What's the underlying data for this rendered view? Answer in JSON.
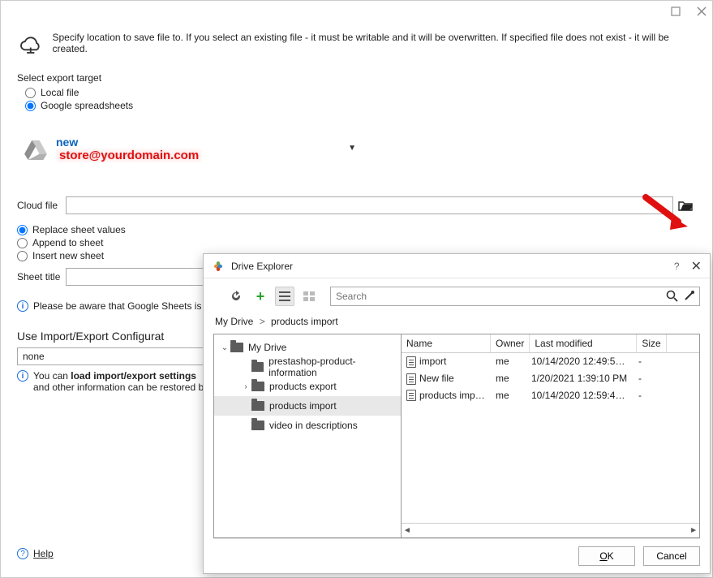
{
  "header": {
    "notice": "Specify location to save file to. If you select an existing file - it must be writable and it will be overwritten. If specified file does not exist - it will be created."
  },
  "target": {
    "label": "Select export target",
    "options": {
      "local": "Local file",
      "google": "Google spreadsheets"
    }
  },
  "account": {
    "name": "new",
    "email": "store@yourdomain.com"
  },
  "cloudfile": {
    "label": "Cloud file",
    "value": ""
  },
  "sheetOpts": {
    "replace": "Replace sheet values",
    "append": "Append to sheet",
    "insert": "Insert new sheet"
  },
  "sheetTitle": {
    "label": "Sheet title",
    "value": ""
  },
  "sheetsWarning": "Please be aware that Google Sheets is l",
  "config": {
    "title": "Use Import/Export Configurat",
    "value": "none",
    "desc_prefix": "You can ",
    "desc_bold": "load import/export settings",
    "desc_suffix": " and other information can be restored by"
  },
  "help": "Help",
  "modal": {
    "title": "Drive Explorer",
    "searchPlaceholder": "Search",
    "breadcrumb": {
      "root": "My Drive",
      "current": "products import"
    },
    "tree": {
      "root": "My Drive",
      "children": [
        "prestashop-product-information",
        "products export",
        "products import",
        "video in descriptions"
      ]
    },
    "columns": {
      "name": "Name",
      "owner": "Owner",
      "mod": "Last modified",
      "size": "Size"
    },
    "rows": [
      {
        "name": "import",
        "owner": "me",
        "mod": "10/14/2020 12:49:51...",
        "size": "-"
      },
      {
        "name": "New file",
        "owner": "me",
        "mod": "1/20/2021 1:39:10 PM",
        "size": "-"
      },
      {
        "name": "products import",
        "owner": "me",
        "mod": "10/14/2020 12:59:41...",
        "size": "-"
      }
    ],
    "ok": "OK",
    "cancel": "Cancel"
  }
}
